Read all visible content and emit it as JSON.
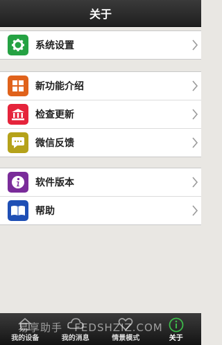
{
  "header": {
    "title": "关于"
  },
  "groups": [
    {
      "items": [
        {
          "label": "系统设置",
          "icon": "gear-icon",
          "color": "#25a243"
        }
      ]
    },
    {
      "items": [
        {
          "label": "新功能介绍",
          "icon": "grid-icon",
          "color": "#e0621b"
        },
        {
          "label": "检查更新",
          "icon": "bank-icon",
          "color": "#e5243b"
        },
        {
          "label": "微信反馈",
          "icon": "chat-icon",
          "color": "#b5a21a"
        }
      ]
    },
    {
      "items": [
        {
          "label": "软件版本",
          "icon": "info-icon",
          "color": "#7a2c9a"
        },
        {
          "label": "帮助",
          "icon": "book-icon",
          "color": "#1f4fb5"
        }
      ]
    }
  ],
  "tabs": [
    {
      "label": "我的设备",
      "icon": "home-icon"
    },
    {
      "label": "我的消息",
      "icon": "cloud-icon"
    },
    {
      "label": "情景模式",
      "icon": "heart-icon"
    },
    {
      "label": "关于",
      "icon": "info-circle-icon",
      "active": true
    }
  ],
  "watermark": "易享助手 · FEDSHZIZ.COM"
}
